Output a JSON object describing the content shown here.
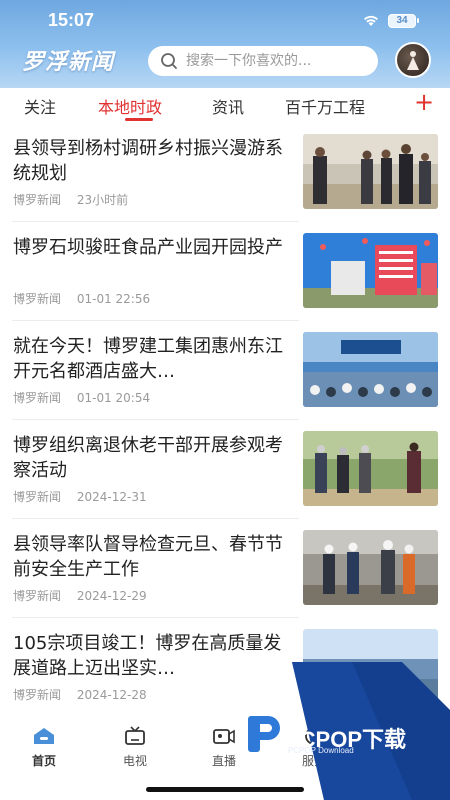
{
  "status_bar": {
    "time": "15:07",
    "battery": "34"
  },
  "header": {
    "logo_text": "罗浮新闻",
    "search_placeholder": "搜索一下你喜欢的..."
  },
  "tabs": [
    {
      "label": "关注"
    },
    {
      "label": "本地时政",
      "active": true
    },
    {
      "label": "资讯"
    },
    {
      "label": "百千万工程"
    }
  ],
  "add_tab_label": "+",
  "articles": [
    {
      "title": "县领导到杨村调研乡村振兴漫游系统规划",
      "source": "博罗新闻",
      "date": "23小时前"
    },
    {
      "title": "博罗石坝骏旺食品产业园开园投产",
      "source": "博罗新闻",
      "date": "01-01 22:56"
    },
    {
      "title": "就在今天！博罗建工集团惠州东江开元名都酒店盛大…",
      "source": "博罗新闻",
      "date": "01-01 20:54"
    },
    {
      "title": "博罗组织离退休老干部开展参观考察活动",
      "source": "博罗新闻",
      "date": "2024-12-31"
    },
    {
      "title": "县领导率队督导检查元旦、春节节前安全生产工作",
      "source": "博罗新闻",
      "date": "2024-12-29"
    },
    {
      "title": "105宗项目竣工！博罗在高质量发展道路上迈出坚实…",
      "source": "博罗新闻",
      "date": "2024-12-28"
    }
  ],
  "bottom_nav": [
    {
      "label": "首页",
      "icon": "home-icon",
      "active": true
    },
    {
      "label": "电视",
      "icon": "tv-icon"
    },
    {
      "label": "直播",
      "icon": "video-icon"
    },
    {
      "label": "服务",
      "icon": "service-icon"
    }
  ],
  "watermark": {
    "text": "PCPOP下载",
    "sub": "PCPOP Download"
  },
  "colors": {
    "accent": "#e0322f",
    "header_blue": "#7fb3e8",
    "nav_active": "#4a90d9"
  }
}
